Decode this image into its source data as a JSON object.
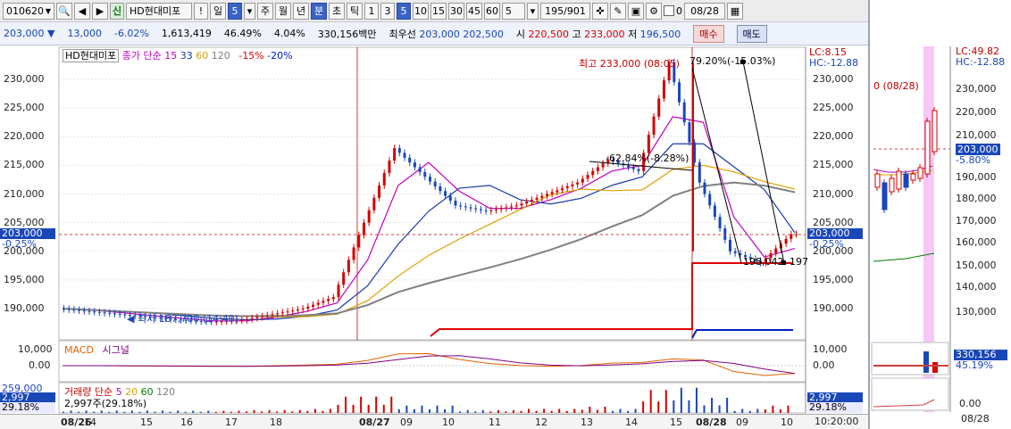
{
  "toolbar": {
    "code": "010620",
    "sin_label": "신",
    "name": "HD현대미포",
    "period_day": "일",
    "period_num": "5",
    "weekly": "주",
    "monthly": "월",
    "yearly": "년",
    "minute": "분",
    "second": "초",
    "tick": "틱",
    "intervals": [
      "1",
      "3",
      "5",
      "10",
      "15",
      "30",
      "45",
      "60"
    ],
    "count_value": "5",
    "page_count": "195/901",
    "checkbox_label": "0",
    "date": "08/28"
  },
  "quote_bar": {
    "price": "203,000",
    "change": "13,000",
    "change_pct": "-6.02%",
    "volume": "1,613,419",
    "ratio1": "46.49%",
    "ratio2": "4.04%",
    "amount": "330,156백만",
    "best_label": "최우선",
    "best_bid": "203,000",
    "best_ask": "202,500",
    "open_label": "시",
    "open": "220,500",
    "high_label": "고",
    "high": "233,000",
    "low_label": "저",
    "low": "196,500",
    "buy": "매수",
    "sell": "매도"
  },
  "main_chart": {
    "legend_name": "HD현대미포",
    "legend_ma": "종가 단순",
    "ma_periods": [
      "15",
      "33",
      "60",
      "120"
    ],
    "env_pcts": [
      "-15%",
      "-20%"
    ],
    "lc": "LC:8.15",
    "hc": "HC:-12.88",
    "y_ticks": [
      "230,000",
      "225,000",
      "220,000",
      "215,000",
      "210,000",
      "205,000",
      "200,000",
      "195,000",
      "190,000"
    ],
    "current_price": "203,000",
    "current_pct": "-0.25%",
    "high_note": "최고 233,000 (08:05)",
    "low_note": "최저 187,700 (14:40)",
    "fib_top": "79.20%(-15.03%)",
    "fib_mid": "-62.84%(-8.28%)",
    "fib_low": "198,042",
    "fib_low2": "197"
  },
  "macd": {
    "title": "MACD",
    "signal": "시그널",
    "y_ticks": [
      "10,000",
      "0.00"
    ]
  },
  "volume": {
    "title": "거래량 단순",
    "periods": [
      "5",
      "20",
      "60",
      "120"
    ],
    "current": "2,997주(29.18%)",
    "value_box": "2,997",
    "pct_box": "29.18%",
    "prev_box": "259,000"
  },
  "time_axis": {
    "labels": [
      "08/26",
      "14",
      "15",
      "16",
      "17",
      "18",
      "08/27",
      "09",
      "10",
      "11",
      "12",
      "13",
      "14",
      "15",
      "08/28",
      "09",
      "10"
    ],
    "clock": "10:20:00"
  },
  "right_panel": {
    "lc": "LC:49.82",
    "hc": "HC:-12.88",
    "note": "0 (08/28)",
    "y_ticks": [
      "230,000",
      "220,000",
      "210,000",
      "203,000",
      "190,000",
      "180,000",
      "170,000",
      "160,000",
      "150,000",
      "140,000",
      "130,000"
    ],
    "current_pct": "-5.80%",
    "vol_value": "330,156",
    "vol_pct": "45.19%",
    "vol_zero": "0.00",
    "date": "08/28"
  },
  "colors": {
    "candle_up": "#d40000",
    "candle_down": "#1947b8",
    "ma15": "#c000c0",
    "ma33": "#1a3aa8",
    "ma60": "#e0a000",
    "ma120": "#808080"
  },
  "chart_data": {
    "type": "line",
    "series": [
      {
        "name": "HD현대미포",
        "values": [
          190000,
          189500,
          189000,
          188500,
          188000,
          187700,
          188000,
          189000,
          190000,
          192000,
          205000,
          218000,
          213000,
          208000,
          207000,
          208000,
          210000,
          212000,
          216000,
          214000,
          233000,
          212000,
          200000,
          198000,
          203000
        ]
      }
    ],
    "ylim": [
      187000,
      233000
    ]
  }
}
